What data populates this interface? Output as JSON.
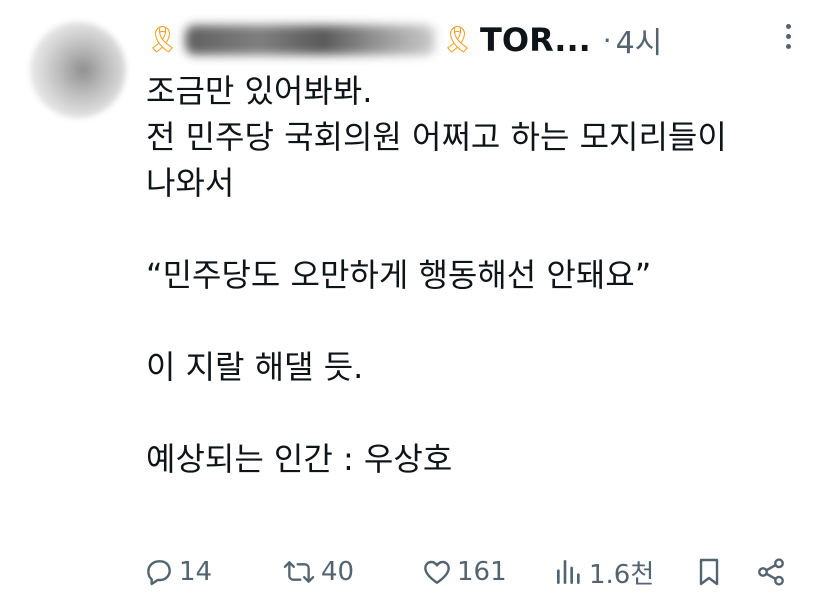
{
  "tweet": {
    "handle_visible": "TOR...",
    "separator": "·",
    "time": "4시",
    "lines": [
      "조금만 있어봐봐.",
      "전 민주당 국회의원 어쩌고 하는 모지리들이",
      "나와서",
      "",
      "“민주당도 오만하게 행동해선 안돼요”",
      "",
      "이 지랄 해댈 듯.",
      "",
      "예상되는 인간 : 우상호"
    ]
  },
  "actions": {
    "reply_count": "14",
    "retweet_count": "40",
    "like_count": "161",
    "view_count": "1.6천"
  },
  "colors": {
    "text": "#0f1419",
    "muted": "#536471",
    "ribbon": "#f0a020"
  }
}
